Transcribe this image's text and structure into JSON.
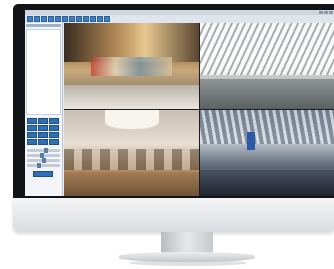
{
  "app": {
    "toolbar": {
      "buttons": [
        "live-view-icon",
        "playback-icon",
        "record-icon",
        "snapshot-icon",
        "layout-icon",
        "settings-icon",
        "alarm-icon",
        "log-icon",
        "user-icon",
        "device-icon",
        "map-icon",
        "exit-icon"
      ]
    },
    "window_controls": [
      "minimize-icon",
      "maximize-icon",
      "close-icon"
    ],
    "sidebar": {
      "ptz_buttons": [
        "ptz-up-left",
        "ptz-up",
        "ptz-up-right",
        "ptz-left",
        "ptz-center",
        "ptz-right",
        "ptz-down-left",
        "ptz-down",
        "ptz-down-right"
      ],
      "ptz_lens_buttons": [
        "zoom-in",
        "zoom-out",
        "focus"
      ],
      "sliders": [
        {
          "name": "brightness",
          "value": 0.6
        },
        {
          "name": "contrast",
          "value": 0.45
        },
        {
          "name": "saturation",
          "value": 0.5
        },
        {
          "name": "speed",
          "value": 0.35
        }
      ]
    },
    "feeds": [
      {
        "id": "camera-feed-1",
        "scene": "mall-atrium"
      },
      {
        "id": "camera-feed-2",
        "scene": "station-roof"
      },
      {
        "id": "camera-feed-3",
        "scene": "office"
      },
      {
        "id": "camera-feed-4",
        "scene": "terminal-hall"
      }
    ]
  },
  "colors": {
    "accent": "#2f6fb3",
    "bezel": "#111316",
    "chin": "#e6e8ea",
    "window": "#e9edf2"
  }
}
